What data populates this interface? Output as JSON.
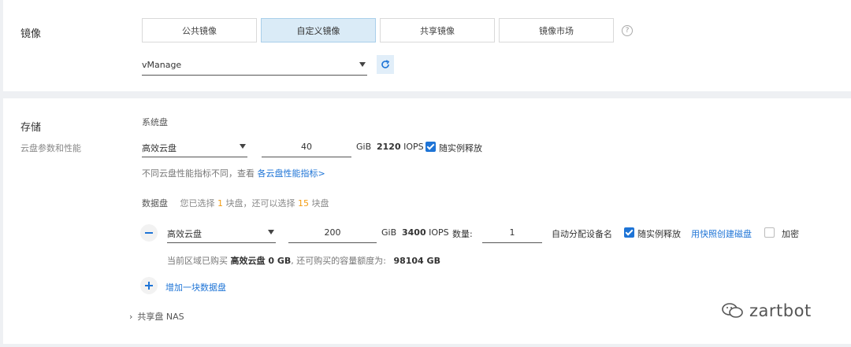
{
  "image_section": {
    "title": "镜像",
    "tabs": [
      {
        "label": "公共镜像",
        "active": false
      },
      {
        "label": "自定义镜像",
        "active": true
      },
      {
        "label": "共享镜像",
        "active": false
      },
      {
        "label": "镜像市场",
        "active": false
      }
    ],
    "help": "?",
    "image_select": {
      "value": "vManage"
    }
  },
  "storage_section": {
    "title": "存储",
    "subtitle": "云盘参数和性能",
    "system_disk": {
      "label": "系统盘",
      "type": "高效云盘",
      "size": "40",
      "unit": "GiB",
      "iops_value": "2120",
      "iops_unit": "IOPS",
      "release_with_instance": {
        "label": "随实例释放",
        "checked": true
      },
      "hint_prefix": "不同云盘性能指标不同，查看",
      "hint_link": "各云盘性能指标>"
    },
    "data_disk": {
      "label": "数据盘",
      "selected_prefix": "您已选择",
      "selected_count": "1",
      "selected_mid": "块盘，还可以选择",
      "remaining_count": "15",
      "selected_suffix": "块盘",
      "disk": {
        "type": "高效云盘",
        "size": "200",
        "unit": "GiB",
        "iops_value": "3400",
        "iops_unit": "IOPS",
        "quantity_label": "数量:",
        "quantity": "1",
        "auto_device_name": "自动分配设备名",
        "release_with_instance": {
          "label": "随实例释放",
          "checked": true
        },
        "snapshot_link": "用快照创建磁盘",
        "encrypt": {
          "label": "加密",
          "checked": false
        }
      },
      "quota_prefix": "当前区域已购买",
      "quota_bought": "高效云盘 0 GB",
      "quota_mid": ", 还可购买的容量额度为:",
      "quota_available": "98104 GB",
      "add_disk": "增加一块数据盘"
    },
    "nas": {
      "label": "共享盘 NAS"
    }
  },
  "watermark": {
    "text": "zartbot"
  },
  "colors": {
    "accent": "#1e74d6",
    "active_tab_bg": "#daebf7",
    "orange": "#f39c12"
  }
}
